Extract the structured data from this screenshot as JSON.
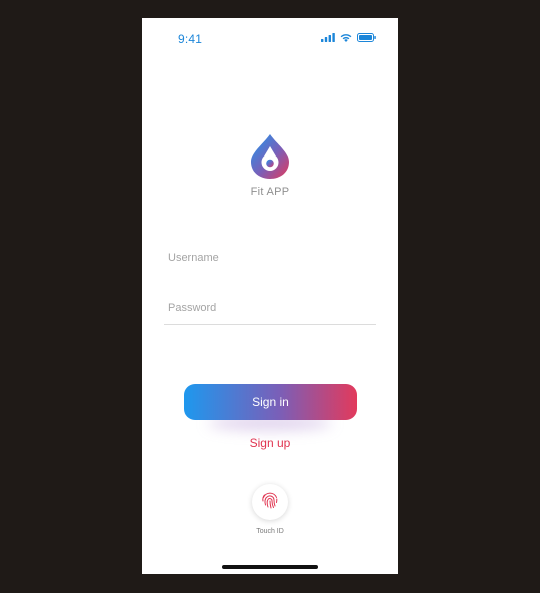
{
  "status_bar": {
    "time": "9:41",
    "icons": [
      "cellular-signal-icon",
      "wifi-icon",
      "battery-icon"
    ],
    "icon_color": "#1c86d9"
  },
  "app": {
    "name": "Fit APP",
    "logo_icon": "water-drop-logo-icon",
    "brand_colors": [
      "#1e98ee",
      "#7a5fb8",
      "#e23a5c"
    ]
  },
  "form": {
    "username": {
      "placeholder": "Username",
      "value": ""
    },
    "password": {
      "placeholder": "Password",
      "value": ""
    }
  },
  "actions": {
    "signin_label": "Sign in",
    "signup_label": "Sign up",
    "signup_color": "#e0334f"
  },
  "touch_id": {
    "icon": "fingerprint-icon",
    "label": "Touch ID"
  }
}
